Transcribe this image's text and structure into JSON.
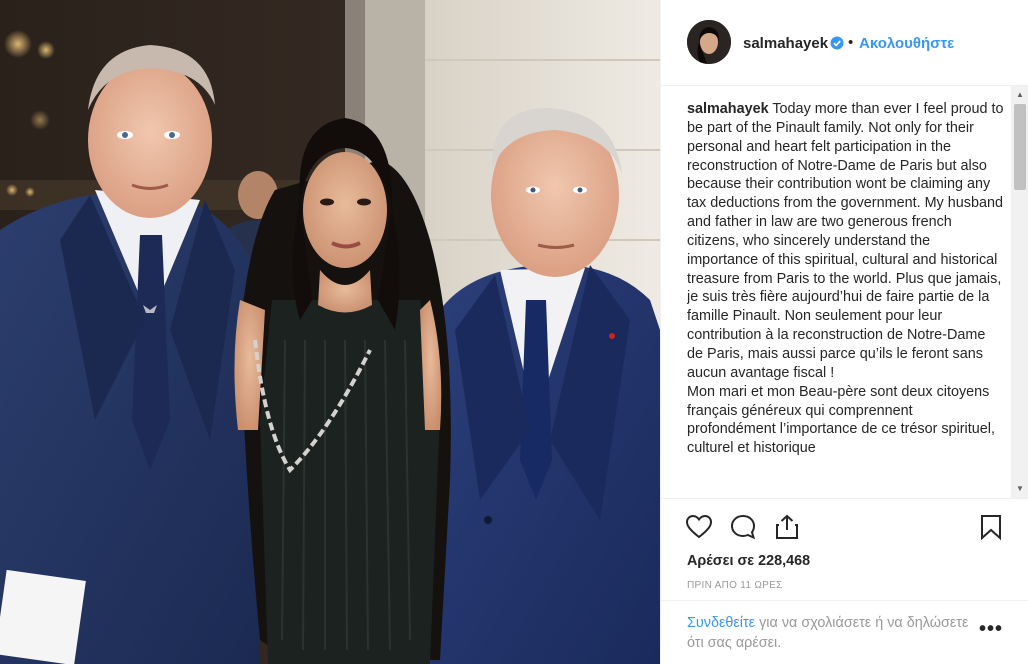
{
  "post": {
    "username": "salmahayek",
    "verified_icon": "verified-badge-icon",
    "separator": "•",
    "follow_label": "Ακολουθήστε",
    "caption_username": "salmahayek",
    "caption_text": "Today more than ever I feel proud to be part of the Pinault family. Not only for their personal and heart felt participation in the reconstruction of Notre-Dame de Paris but also because their contribution wont be claiming any tax deductions from the government. My husband and father in law are two generous french citizens, who sincerely understand the importance of this spiritual, cultural and historical treasure from Paris to the world. Plus que jamais, je suis très fière aujourd’hui de faire partie de la famille Pinault. Non seulement pour leur contribution à la reconstruction de Notre-Dame de Paris, mais aussi parce qu’ils le feront sans aucun avantage fiscal !",
    "caption_text_2": "Mon mari et mon Beau-père sont deux citoyens français généreux qui comprennent profondément l’importance de ce trésor spirituel, culturel et historique",
    "likes_label": "Αρέσει σε 228,468",
    "time_label": "ΠΡΙΝ ΑΠΟ 11 ΩΡΕΣ",
    "login_link": "Συνδεθείτε",
    "login_rest": " για να σχολιάσετε ή να δηλώσετε ότι σας αρέσει.",
    "more_label": "•••"
  },
  "icons": {
    "like": "heart-icon",
    "comment": "comment-bubble-icon",
    "share": "share-upload-icon",
    "save": "bookmark-icon",
    "more": "more-options-icon"
  },
  "colors": {
    "link_blue": "#3897f0",
    "text": "#262626",
    "muted": "#999999",
    "verified": "#3897f0"
  }
}
